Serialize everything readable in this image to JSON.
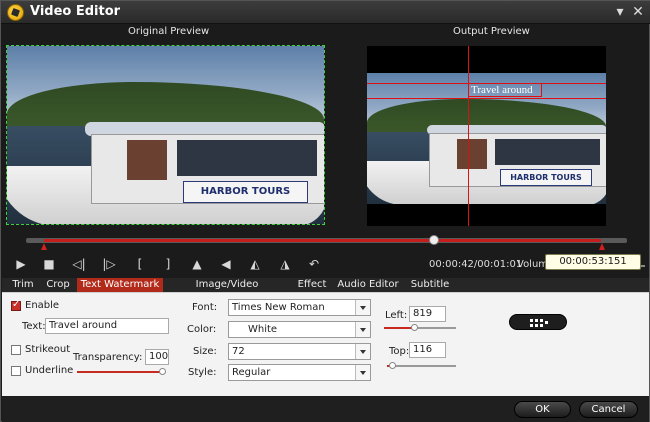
{
  "window": {
    "title": "Video Editor",
    "minimize_glyph": "▾",
    "close_glyph": "✕"
  },
  "preview": {
    "original_label": "Original Preview",
    "output_label": "Output Preview"
  },
  "watermark_preview": {
    "text": "Travel around"
  },
  "boat": {
    "banner_text": "HARBOR TOURS"
  },
  "player": {
    "time": "00:00:42/00:01:01",
    "volume_label": "Volum",
    "tooltip": "00:00:53:151",
    "progress_fraction": 0.7,
    "controls": [
      "play-icon",
      "stop-icon",
      "prev-frame-icon",
      "next-frame-icon",
      "mark-in-icon",
      "mark-out-icon",
      "flip-vertical-icon",
      "flip-horizontal-icon",
      "rotate-left-icon",
      "rotate-right-icon",
      "undo-icon"
    ]
  },
  "tabs": [
    "Trim",
    "Crop",
    "Text Watermark",
    "Image/Video Watermark",
    "Effect",
    "Audio Editor",
    "Subtitle"
  ],
  "active_tab": "Text Watermark",
  "text_watermark": {
    "enable_label": "Enable",
    "enable_checked": true,
    "text_label": "Text:",
    "text_value": "Travel around",
    "strikeout_label": "Strikeout",
    "underline_label": "Underline",
    "transparency_label": "Transparency:",
    "transparency_value": "100",
    "font_label": "Font:",
    "font_value": "Times New Roman",
    "color_label": "Color:",
    "color_value": "White",
    "size_label": "Size:",
    "size_value": "72",
    "style_label": "Style:",
    "style_value": "Regular",
    "left_label": "Left:",
    "left_value": "819",
    "top_label": "Top:",
    "top_value": "116"
  },
  "footer": {
    "ok_label": "OK",
    "cancel_label": "Cancel"
  },
  "colors": {
    "accent": "#b22a1a",
    "preview_border": "#3fd23f",
    "tooltip_bg": "#fffde6"
  }
}
